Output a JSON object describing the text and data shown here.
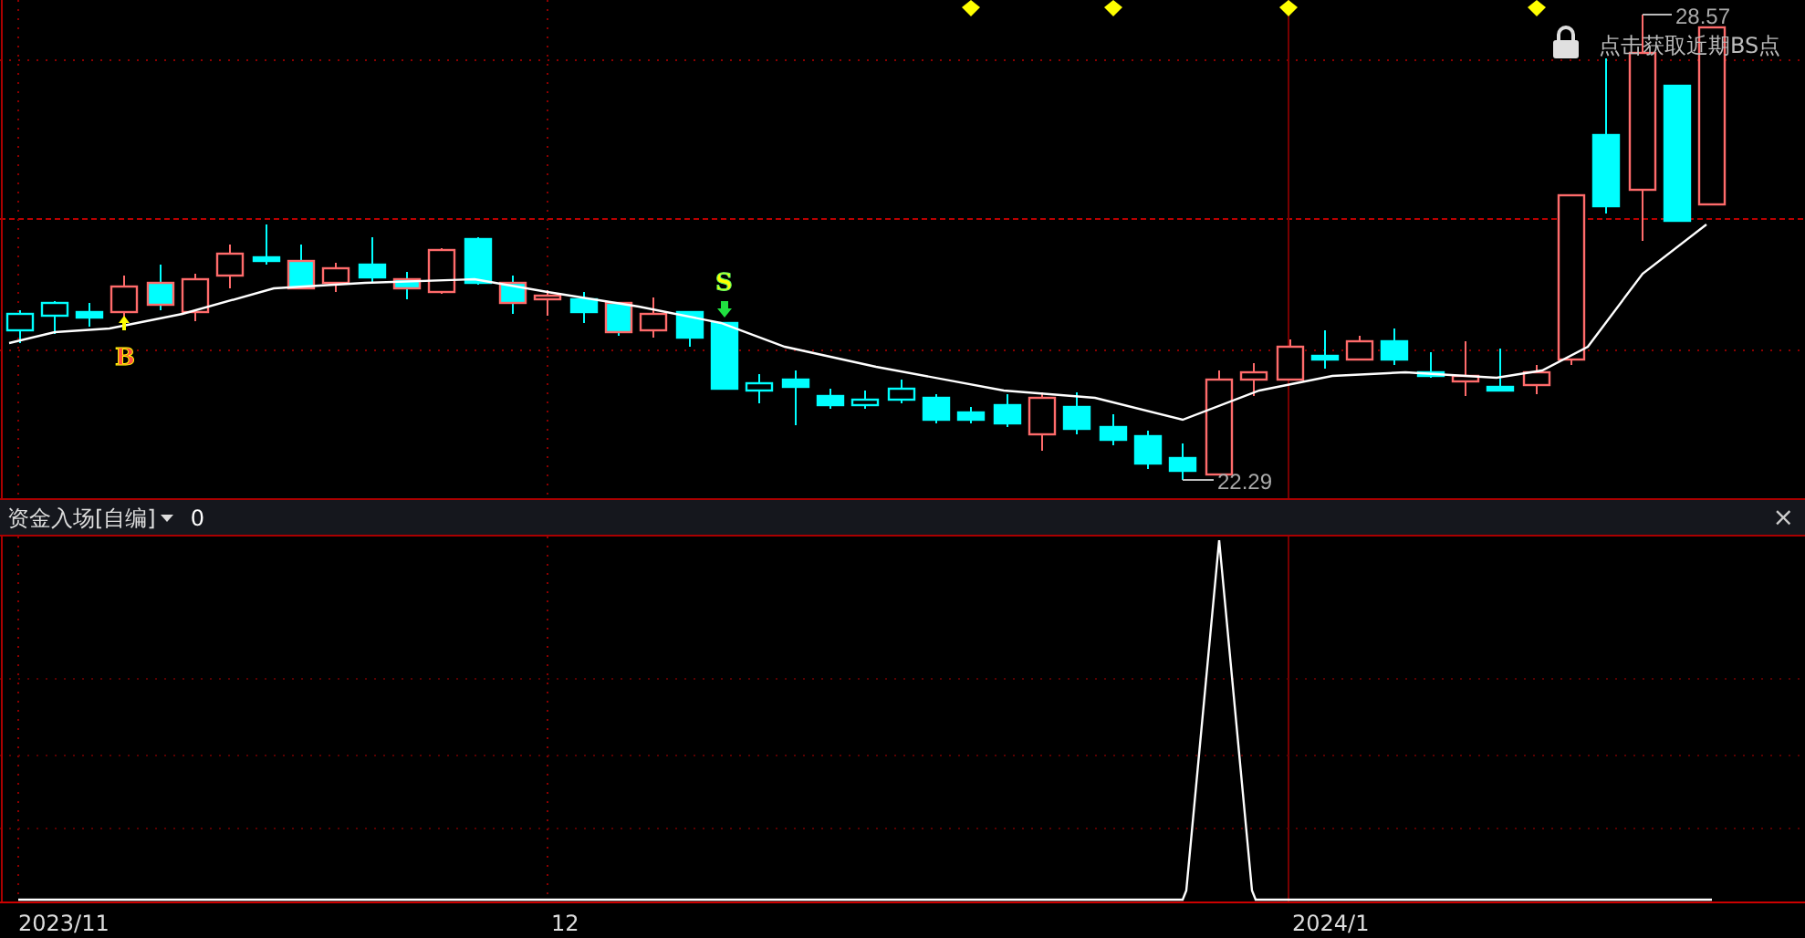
{
  "chart": {
    "price_high_label": "28.57",
    "price_low_label": "22.29",
    "buy_marker": "B",
    "sell_marker": "S",
    "bs_points_link": "点击获取近期BS点"
  },
  "indicator": {
    "title": "资金入场[自编]",
    "value": "0",
    "close_label": "×"
  },
  "time_axis": {
    "labels": [
      "2023/11",
      "12",
      "2024/1"
    ]
  }
}
